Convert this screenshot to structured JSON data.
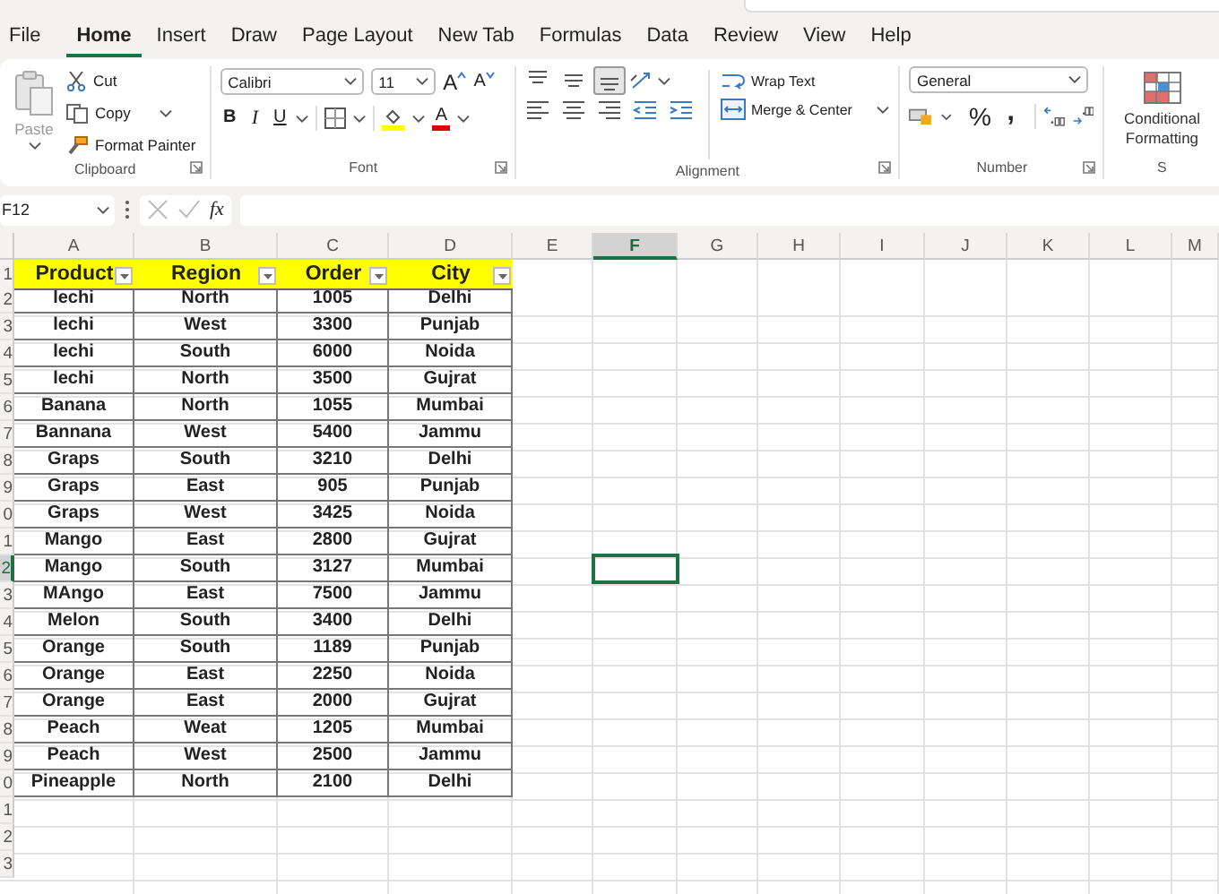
{
  "menu_tabs": [
    {
      "label": "File",
      "selected": false
    },
    {
      "label": "Home",
      "selected": true
    },
    {
      "label": "Insert",
      "selected": false
    },
    {
      "label": "Draw",
      "selected": false
    },
    {
      "label": "Page Layout",
      "selected": false
    },
    {
      "label": "New Tab",
      "selected": false
    },
    {
      "label": "Formulas",
      "selected": false
    },
    {
      "label": "Data",
      "selected": false
    },
    {
      "label": "Review",
      "selected": false
    },
    {
      "label": "View",
      "selected": false
    },
    {
      "label": "Help",
      "selected": false
    }
  ],
  "clipboard": {
    "paste": "Paste",
    "cut": "Cut",
    "copy": "Copy",
    "format_painter": "Format Painter",
    "label": "Clipboard"
  },
  "font": {
    "name": "Calibri",
    "size": "11",
    "grow": "A",
    "shrink": "A",
    "bold": "B",
    "italic": "I",
    "underline": "U",
    "font_color": "A",
    "label": "Font"
  },
  "alignment": {
    "wrap": "Wrap Text",
    "merge": "Merge & Center",
    "label": "Alignment"
  },
  "number": {
    "format": "General",
    "percent": "%",
    "comma": ",",
    "label": "Number"
  },
  "styles": {
    "conditional": "Conditional Formatting",
    "label": "S"
  },
  "formula_bar": {
    "name_box": "F12",
    "fx": "fx"
  },
  "sheet": {
    "columns": [
      {
        "label": "A",
        "selected": false
      },
      {
        "label": "B",
        "selected": false
      },
      {
        "label": "C",
        "selected": false
      },
      {
        "label": "D",
        "selected": false
      },
      {
        "label": "E",
        "selected": false
      },
      {
        "label": "F",
        "selected": true
      },
      {
        "label": "G",
        "selected": false
      },
      {
        "label": "H",
        "selected": false
      },
      {
        "label": "I",
        "selected": false
      },
      {
        "label": "J",
        "selected": false
      },
      {
        "label": "K",
        "selected": false
      },
      {
        "label": "L",
        "selected": false
      },
      {
        "label": "M",
        "selected": false
      }
    ],
    "rows": [
      {
        "label": "1",
        "selected": false
      },
      {
        "label": "2",
        "selected": false
      },
      {
        "label": "3",
        "selected": false
      },
      {
        "label": "4",
        "selected": false
      },
      {
        "label": "5",
        "selected": false
      },
      {
        "label": "6",
        "selected": false
      },
      {
        "label": "7",
        "selected": false
      },
      {
        "label": "8",
        "selected": false
      },
      {
        "label": "9",
        "selected": false
      },
      {
        "label": "0",
        "selected": false
      },
      {
        "label": "1",
        "selected": false
      },
      {
        "label": "2",
        "selected": true
      },
      {
        "label": "3",
        "selected": false
      },
      {
        "label": "4",
        "selected": false
      },
      {
        "label": "5",
        "selected": false
      },
      {
        "label": "6",
        "selected": false
      },
      {
        "label": "7",
        "selected": false
      },
      {
        "label": "8",
        "selected": false
      },
      {
        "label": "9",
        "selected": false
      },
      {
        "label": "0",
        "selected": false
      },
      {
        "label": "1",
        "selected": false
      },
      {
        "label": "2",
        "selected": false
      },
      {
        "label": "3",
        "selected": false
      }
    ],
    "table": {
      "headers": [
        "Product",
        "Region",
        "Order",
        "City"
      ],
      "rows": [
        [
          "lechi",
          "North",
          "1005",
          "Delhi"
        ],
        [
          "lechi",
          "West",
          "3300",
          "Punjab"
        ],
        [
          "lechi",
          "South",
          "6000",
          "Noida"
        ],
        [
          "lechi",
          "North",
          "3500",
          "Gujrat"
        ],
        [
          "Banana",
          "North",
          "1055",
          "Mumbai"
        ],
        [
          "Bannana",
          "West",
          "5400",
          "Jammu"
        ],
        [
          "Graps",
          "South",
          "3210",
          "Delhi"
        ],
        [
          "Graps",
          "East",
          "905",
          "Punjab"
        ],
        [
          "Graps",
          "West",
          "3425",
          "Noida"
        ],
        [
          "Mango",
          "East",
          "2800",
          "Gujrat"
        ],
        [
          "Mango",
          "South",
          "3127",
          "Mumbai"
        ],
        [
          "MAngo",
          "East",
          "7500",
          "Jammu"
        ],
        [
          "Melon",
          "South",
          "3400",
          "Delhi"
        ],
        [
          "Orange",
          "South",
          "1189",
          "Punjab"
        ],
        [
          "Orange",
          "East",
          "2250",
          "Noida"
        ],
        [
          "Orange",
          "East",
          "2000",
          "Gujrat"
        ],
        [
          "Peach",
          "Weat",
          "1205",
          "Mumbai"
        ],
        [
          "Peach",
          "West",
          "2500",
          "Jammu"
        ],
        [
          "Pineapple",
          "North",
          "2100",
          "Delhi"
        ]
      ]
    }
  }
}
